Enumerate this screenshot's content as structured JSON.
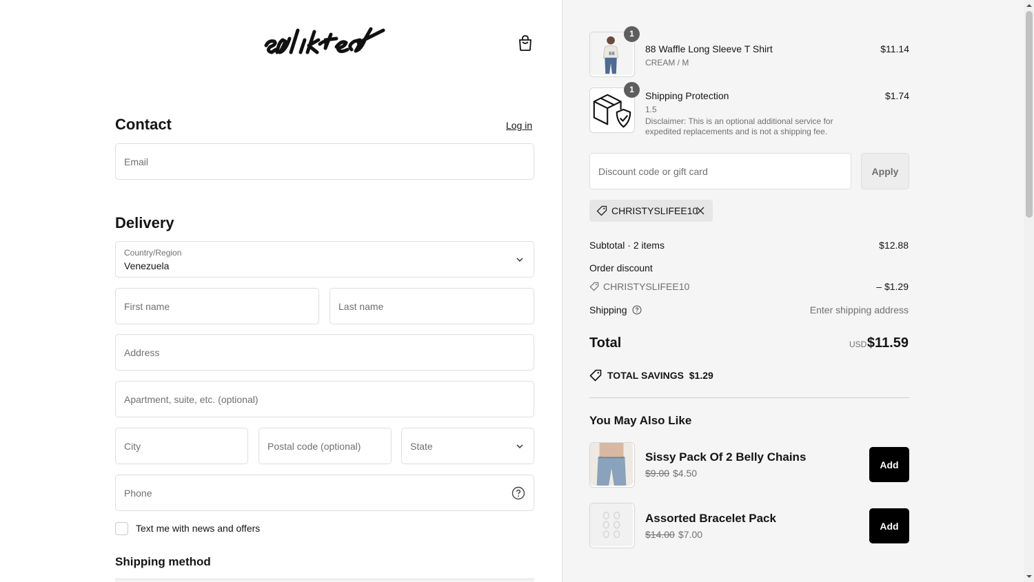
{
  "brand": {
    "logo_text": "enlisted"
  },
  "contact": {
    "heading": "Contact",
    "login_link": "Log in",
    "email_placeholder": "Email"
  },
  "delivery": {
    "heading": "Delivery",
    "country_label": "Country/Region",
    "country_value": "Venezuela",
    "first_name_placeholder": "First name",
    "last_name_placeholder": "Last name",
    "address_placeholder": "Address",
    "apartment_placeholder": "Apartment, suite, etc. (optional)",
    "city_placeholder": "City",
    "postal_placeholder": "Postal code (optional)",
    "state_placeholder": "State",
    "phone_placeholder": "Phone",
    "text_offers_label": "Text me with news and offers"
  },
  "shipping_method": {
    "heading": "Shipping method"
  },
  "cart": {
    "items": [
      {
        "name": "88 Waffle Long Sleeve T Shirt",
        "variant": "CREAM / M",
        "price": "$11.14",
        "qty": "1"
      },
      {
        "name": "Shipping Protection",
        "variant": "1.5",
        "disclaimer": "Disclaimer: This is an optional additional service for expedited replacements and is not a shipping fee.",
        "price": "$1.74",
        "qty": "1"
      }
    ]
  },
  "discount": {
    "placeholder": "Discount code or gift card",
    "apply_label": "Apply",
    "applied_code": "CHRISTYSLIFEE10"
  },
  "summary": {
    "subtotal_label": "Subtotal · 2 items",
    "subtotal_value": "$12.88",
    "order_discount_label": "Order discount",
    "discount_code": "CHRISTYSLIFEE10",
    "discount_value": "– $1.29",
    "shipping_label": "Shipping",
    "shipping_value": "Enter shipping address",
    "total_label": "Total",
    "currency": "USD",
    "total_value": "$11.59",
    "savings_label": "TOTAL SAVINGS",
    "savings_value": "$1.29"
  },
  "recommendations": {
    "heading": "You May Also Like",
    "items": [
      {
        "name": "Sissy Pack Of 2 Belly Chains",
        "old_price": "$9.00",
        "new_price": "$4.50",
        "button": "Add"
      },
      {
        "name": "Assorted Bracelet Pack",
        "old_price": "$14.00",
        "new_price": "$7.00",
        "button": "Add"
      }
    ]
  }
}
